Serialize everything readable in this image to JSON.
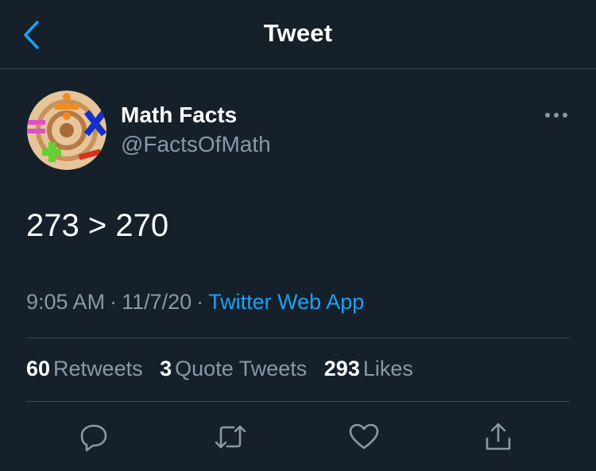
{
  "header": {
    "title": "Tweet",
    "back_icon": "chevron-left-icon"
  },
  "author": {
    "display_name": "Math Facts",
    "handle": "@FactsOfMath",
    "avatar_icon": "math-symbols-avatar"
  },
  "tweet": {
    "text": "273 > 270"
  },
  "meta": {
    "time": "9:05 AM",
    "sep1": "·",
    "date": "11/7/20",
    "sep2": "·",
    "source": "Twitter Web App"
  },
  "stats": {
    "retweets": {
      "count": "60",
      "label": "Retweets"
    },
    "quotes": {
      "count": "3",
      "label": "Quote Tweets"
    },
    "likes": {
      "count": "293",
      "label": "Likes"
    }
  },
  "actions": [
    "reply-icon",
    "retweet-icon",
    "like-icon",
    "share-icon"
  ],
  "colors": {
    "background": "#15202b",
    "secondary_text": "#8899a6",
    "accent": "#1da1f2",
    "divider": "#38444d"
  }
}
